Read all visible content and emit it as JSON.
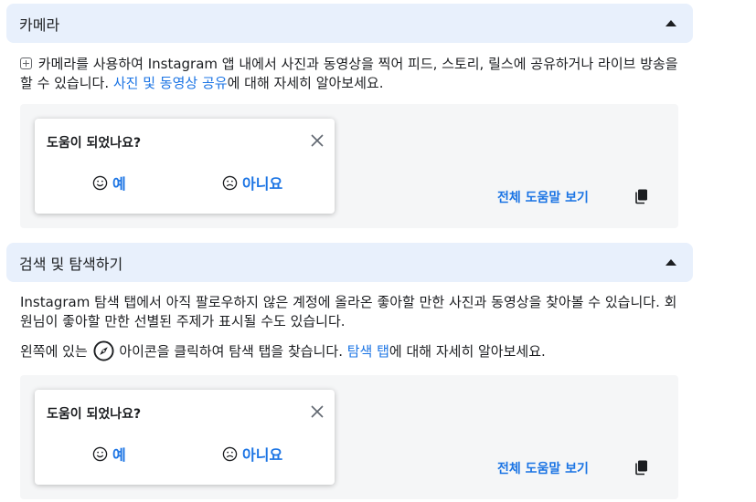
{
  "sections": [
    {
      "title": "카메라",
      "body_prefix": " 카메라를 사용하여 Instagram 앱 내에서 사진과 동영상을 찍어 피드, 스토리, 릴스에 공유하거나 라이브 방송을 할 수 있습니다. ",
      "link": "사진 및 동영상 공유",
      "body_suffix": "에 대해 자세히 알아보세요."
    },
    {
      "title": "검색 및 탐색하기",
      "body1": "Instagram 탐색 탭에서 아직 팔로우하지 않은 계정에 올라온 좋아할 만한 사진과 동영상을 찾아볼 수 있습니다. 회원님이 좋아할 만한 선별된 주제가 표시될 수도 있습니다.",
      "body2_prefix": "왼쪽에 있는 ",
      "body2_mid": " 아이콘을 클릭하여 탐색 탭을 찾습니다. ",
      "link": "탐색 탭",
      "body2_suffix": "에 대해 자세히 알아보세요."
    }
  ],
  "feedback": {
    "question": "도움이 되었나요?",
    "yes_label": "예",
    "no_label": "아니요",
    "see_all": "전체 도움말 보기"
  },
  "colors": {
    "header_bg": "#e8f0fc",
    "link": "#1b74e4",
    "feedback_area_bg": "#f5f6f7"
  },
  "icons": [
    "caret-up-icon",
    "plus-box-icon",
    "compass-icon",
    "close-icon",
    "smile-icon",
    "frown-icon",
    "copy-icon"
  ]
}
